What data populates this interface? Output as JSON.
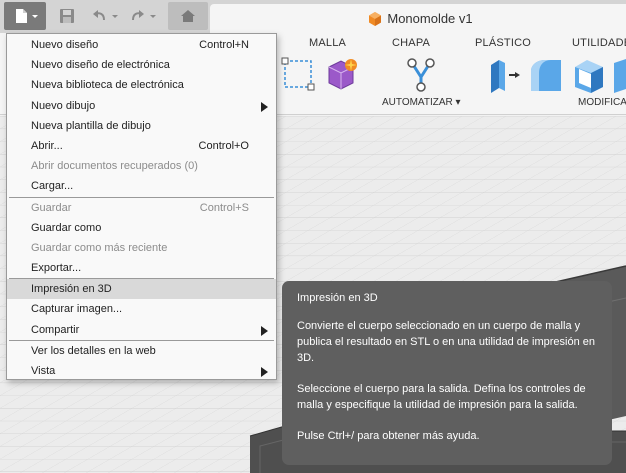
{
  "app": {
    "document_title": "Monomolde v1"
  },
  "toolbar": {
    "sections": {
      "malla": "MALLA",
      "chapa": "CHAPA",
      "plastico": "PLÁSTICO",
      "utilidades": "UTILIDADES"
    },
    "automatizar_label": "AUTOMATIZAR ▾",
    "modificar_label": "MODIFICA",
    "colors": {
      "accent_orange": "#f08a24",
      "mesh_purple": "#9b59c9",
      "solid_blue": "#3a8fd8"
    }
  },
  "file_menu": {
    "items": [
      {
        "label": "Nuevo diseño",
        "shortcut": "Control+N",
        "submenu": false,
        "disabled": false
      },
      {
        "label": "Nuevo diseño de electrónica",
        "shortcut": "",
        "submenu": false,
        "disabled": false
      },
      {
        "label": "Nueva biblioteca de electrónica",
        "shortcut": "",
        "submenu": false,
        "disabled": false
      },
      {
        "label": "Nuevo dibujo",
        "shortcut": "",
        "submenu": true,
        "disabled": false
      },
      {
        "label": "Nueva plantilla de dibujo",
        "shortcut": "",
        "submenu": false,
        "disabled": false
      },
      {
        "label": "Abrir...",
        "shortcut": "Control+O",
        "submenu": false,
        "disabled": false
      },
      {
        "label": "Abrir documentos recuperados (0)",
        "shortcut": "",
        "submenu": false,
        "disabled": true
      },
      {
        "label": "Cargar...",
        "shortcut": "",
        "submenu": false,
        "disabled": false
      },
      {
        "label": "Guardar",
        "shortcut": "Control+S",
        "submenu": false,
        "disabled": true
      },
      {
        "label": "Guardar como",
        "shortcut": "",
        "submenu": false,
        "disabled": false
      },
      {
        "label": "Guardar como más reciente",
        "shortcut": "",
        "submenu": false,
        "disabled": true
      },
      {
        "label": "Exportar...",
        "shortcut": "",
        "submenu": false,
        "disabled": false
      },
      {
        "label": "Impresión en 3D",
        "shortcut": "",
        "submenu": false,
        "disabled": false,
        "highlighted": true
      },
      {
        "label": "Capturar imagen...",
        "shortcut": "",
        "submenu": false,
        "disabled": false
      },
      {
        "label": "Compartir",
        "shortcut": "",
        "submenu": true,
        "disabled": false
      },
      {
        "label": "Ver los detalles en la web",
        "shortcut": "",
        "submenu": false,
        "disabled": false
      },
      {
        "label": "Vista",
        "shortcut": "",
        "submenu": true,
        "disabled": false
      }
    ]
  },
  "tooltip": {
    "title": "Impresión en 3D",
    "paragraph_1": "Convierte el cuerpo seleccionado en un cuerpo de malla y publica el resultado en STL o en una utilidad de impresión en 3D.",
    "paragraph_2": "Seleccione el cuerpo para la salida. Defina los controles de malla y especifique la utilidad de impresión para la salida.",
    "help_hint": "Pulse Ctrl+/ para obtener más ayuda."
  }
}
